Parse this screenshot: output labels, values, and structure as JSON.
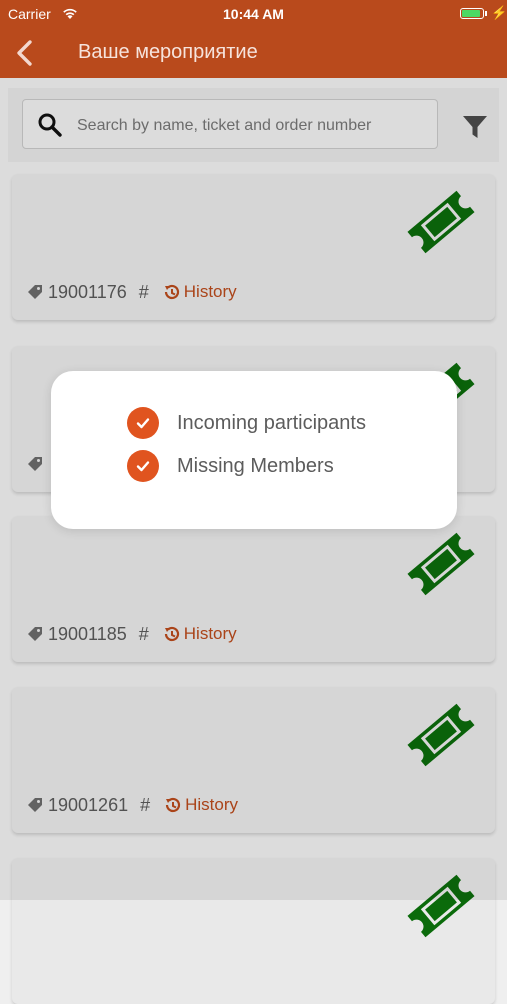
{
  "status_bar": {
    "carrier": "Carrier",
    "time": "10:44 AM",
    "battery_level": 0.8
  },
  "nav": {
    "title": "Ваше  мероприятие"
  },
  "search": {
    "value": "",
    "placeholder": "Search by name, ticket and order number"
  },
  "cards": [
    {
      "number": "19001176",
      "hash": "#",
      "history_label": "History"
    },
    {
      "number": "",
      "hash": "",
      "history_label": ""
    },
    {
      "number": "19001185",
      "hash": "#",
      "history_label": "History"
    },
    {
      "number": "19001261",
      "hash": "#",
      "history_label": "History"
    },
    {
      "number": "",
      "hash": "",
      "history_label": ""
    }
  ],
  "dialog": {
    "options": [
      {
        "label": "Incoming participants",
        "checked": true
      },
      {
        "label": "Missing Members",
        "checked": true
      }
    ]
  },
  "colors": {
    "brand": "#b94a1c",
    "accent": "#e0541f",
    "ticket_green": "#0b6b0b",
    "history": "#b94a1c"
  },
  "icons": [
    "back-icon",
    "search-icon",
    "filter-icon",
    "ticket-icon",
    "tag-icon",
    "history-icon",
    "check-icon",
    "wifi-icon",
    "battery-icon"
  ]
}
